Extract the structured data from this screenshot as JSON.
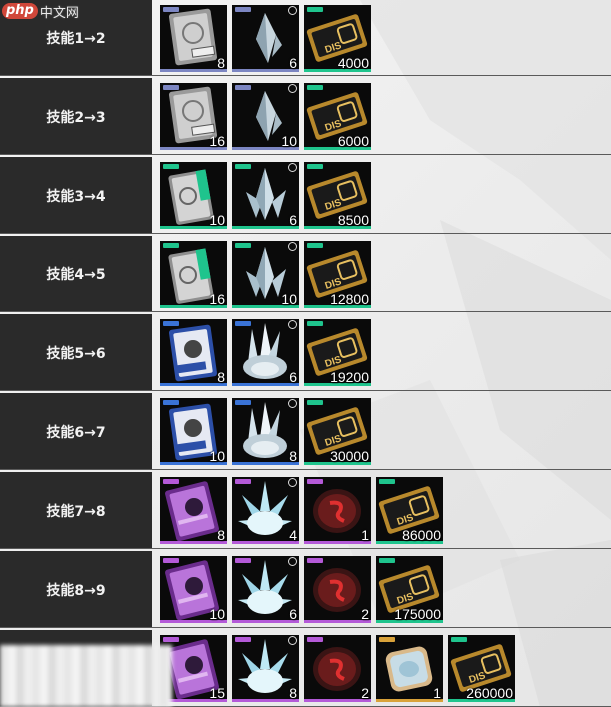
{
  "watermark": {
    "logo": "php",
    "text": "中文网"
  },
  "colors": {
    "rare_green": "#1fc48d",
    "rare_blue": "#3a73d6",
    "rare_purple": "#b45ad8",
    "rare_gold": "#d9a23a"
  },
  "rows": [
    {
      "label": "技能1→2",
      "items": [
        {
          "icon": "silver-medal-card-icon",
          "count": "8"
        },
        {
          "icon": "crystal-shard-icon",
          "count": "6"
        },
        {
          "icon": "gold-ticket-icon",
          "count": "4000"
        }
      ]
    },
    {
      "label": "技能2→3",
      "items": [
        {
          "icon": "silver-medal-card-icon",
          "count": "16"
        },
        {
          "icon": "crystal-shard-icon",
          "count": "10"
        },
        {
          "icon": "gold-ticket-icon",
          "count": "6000"
        }
      ]
    },
    {
      "label": "技能3→4",
      "items": [
        {
          "icon": "green-card-icon",
          "count": "10"
        },
        {
          "icon": "crystal-cluster-icon",
          "count": "6"
        },
        {
          "icon": "gold-ticket-icon",
          "count": "8500"
        }
      ]
    },
    {
      "label": "技能4→5",
      "items": [
        {
          "icon": "green-card-icon",
          "count": "16"
        },
        {
          "icon": "crystal-cluster-icon",
          "count": "10"
        },
        {
          "icon": "gold-ticket-icon",
          "count": "12800"
        }
      ]
    },
    {
      "label": "技能5→6",
      "items": [
        {
          "icon": "blue-mbcc-card-icon",
          "count": "8"
        },
        {
          "icon": "crystal-spikes-icon",
          "count": "6"
        },
        {
          "icon": "gold-ticket-icon",
          "count": "19200"
        }
      ]
    },
    {
      "label": "技能6→7",
      "items": [
        {
          "icon": "blue-mbcc-card-icon",
          "count": "10"
        },
        {
          "icon": "crystal-spikes-icon",
          "count": "8"
        },
        {
          "icon": "gold-ticket-icon",
          "count": "30000"
        }
      ]
    },
    {
      "label": "技能7→8",
      "items": [
        {
          "icon": "purple-card-icon",
          "count": "8"
        },
        {
          "icon": "crystal-burst-icon",
          "count": "4"
        },
        {
          "icon": "red-stone-icon",
          "count": "1"
        },
        {
          "icon": "gold-ticket-icon",
          "count": "86000"
        }
      ]
    },
    {
      "label": "技能8→9",
      "items": [
        {
          "icon": "purple-card-icon",
          "count": "10"
        },
        {
          "icon": "crystal-burst-icon",
          "count": "6"
        },
        {
          "icon": "red-stone-icon",
          "count": "2"
        },
        {
          "icon": "gold-ticket-icon",
          "count": "175000"
        }
      ]
    },
    {
      "label": "",
      "items": [
        {
          "icon": "purple-card-icon",
          "count": "15"
        },
        {
          "icon": "crystal-burst-icon",
          "count": "8"
        },
        {
          "icon": "red-stone-icon",
          "count": "2"
        },
        {
          "icon": "opal-gem-icon",
          "count": "1"
        },
        {
          "icon": "gold-ticket-icon",
          "count": "260000"
        }
      ]
    }
  ]
}
